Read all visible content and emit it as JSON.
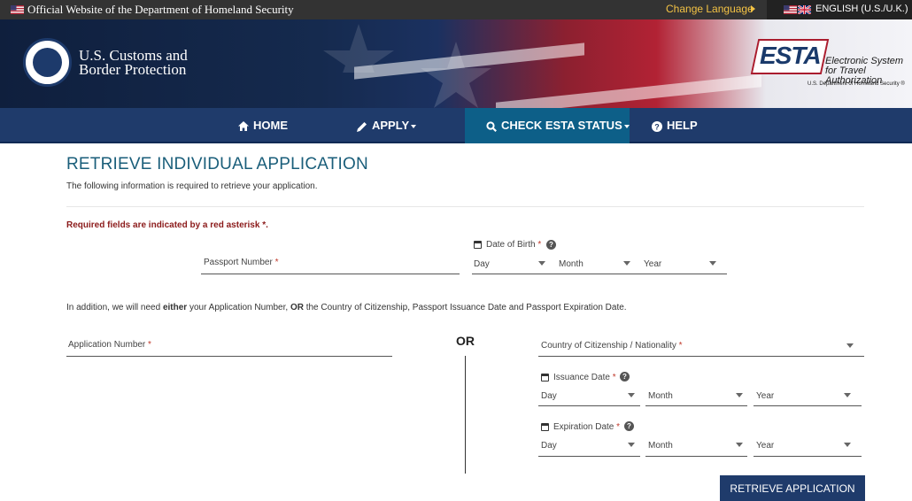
{
  "gov_bar": {
    "official_text": "Official Website of the Department of Homeland Security",
    "change_language": "Change Language",
    "current_language": "ENGLISH (U.S./U.K.)"
  },
  "header": {
    "agency_line1": "U.S. Customs and",
    "agency_line2": "Border Protection",
    "esta_word": "ESTA",
    "esta_desc": "Electronic System for Travel Authorization",
    "esta_sub": "U.S. Department of Homeland Security ®"
  },
  "nav": {
    "home": "HOME",
    "apply": "APPLY",
    "check_status": "CHECK ESTA STATUS",
    "help": "HELP"
  },
  "page": {
    "title": "RETRIEVE INDIVIDUAL APPLICATION",
    "intro": "The following information is required to retrieve your application.",
    "required_note": "Required fields are indicated by a red asterisk *.",
    "addition_prefix": "In addition, we will need ",
    "addition_either": "either",
    "addition_middle": " your Application Number, ",
    "addition_or": "OR",
    "addition_suffix": " the Country of Citizenship, Passport Issuance Date and Passport Expiration Date.",
    "or_label": "OR"
  },
  "form": {
    "passport_number_label": "Passport Number",
    "dob_label": "Date of Birth",
    "application_number_label": "Application Number",
    "country_label": "Country of Citizenship / Nationality",
    "issuance_label": "Issuance Date",
    "expiration_label": "Expiration Date",
    "asterisk": "*",
    "day": "Day",
    "month": "Month",
    "year": "Year",
    "submit": "RETRIEVE APPLICATION"
  },
  "colors": {
    "nav_bg": "#1f3b6b",
    "nav_active": "#0d5f88",
    "title": "#1a5e7a",
    "required": "#8b1a1a",
    "change_language": "#f3c244"
  }
}
